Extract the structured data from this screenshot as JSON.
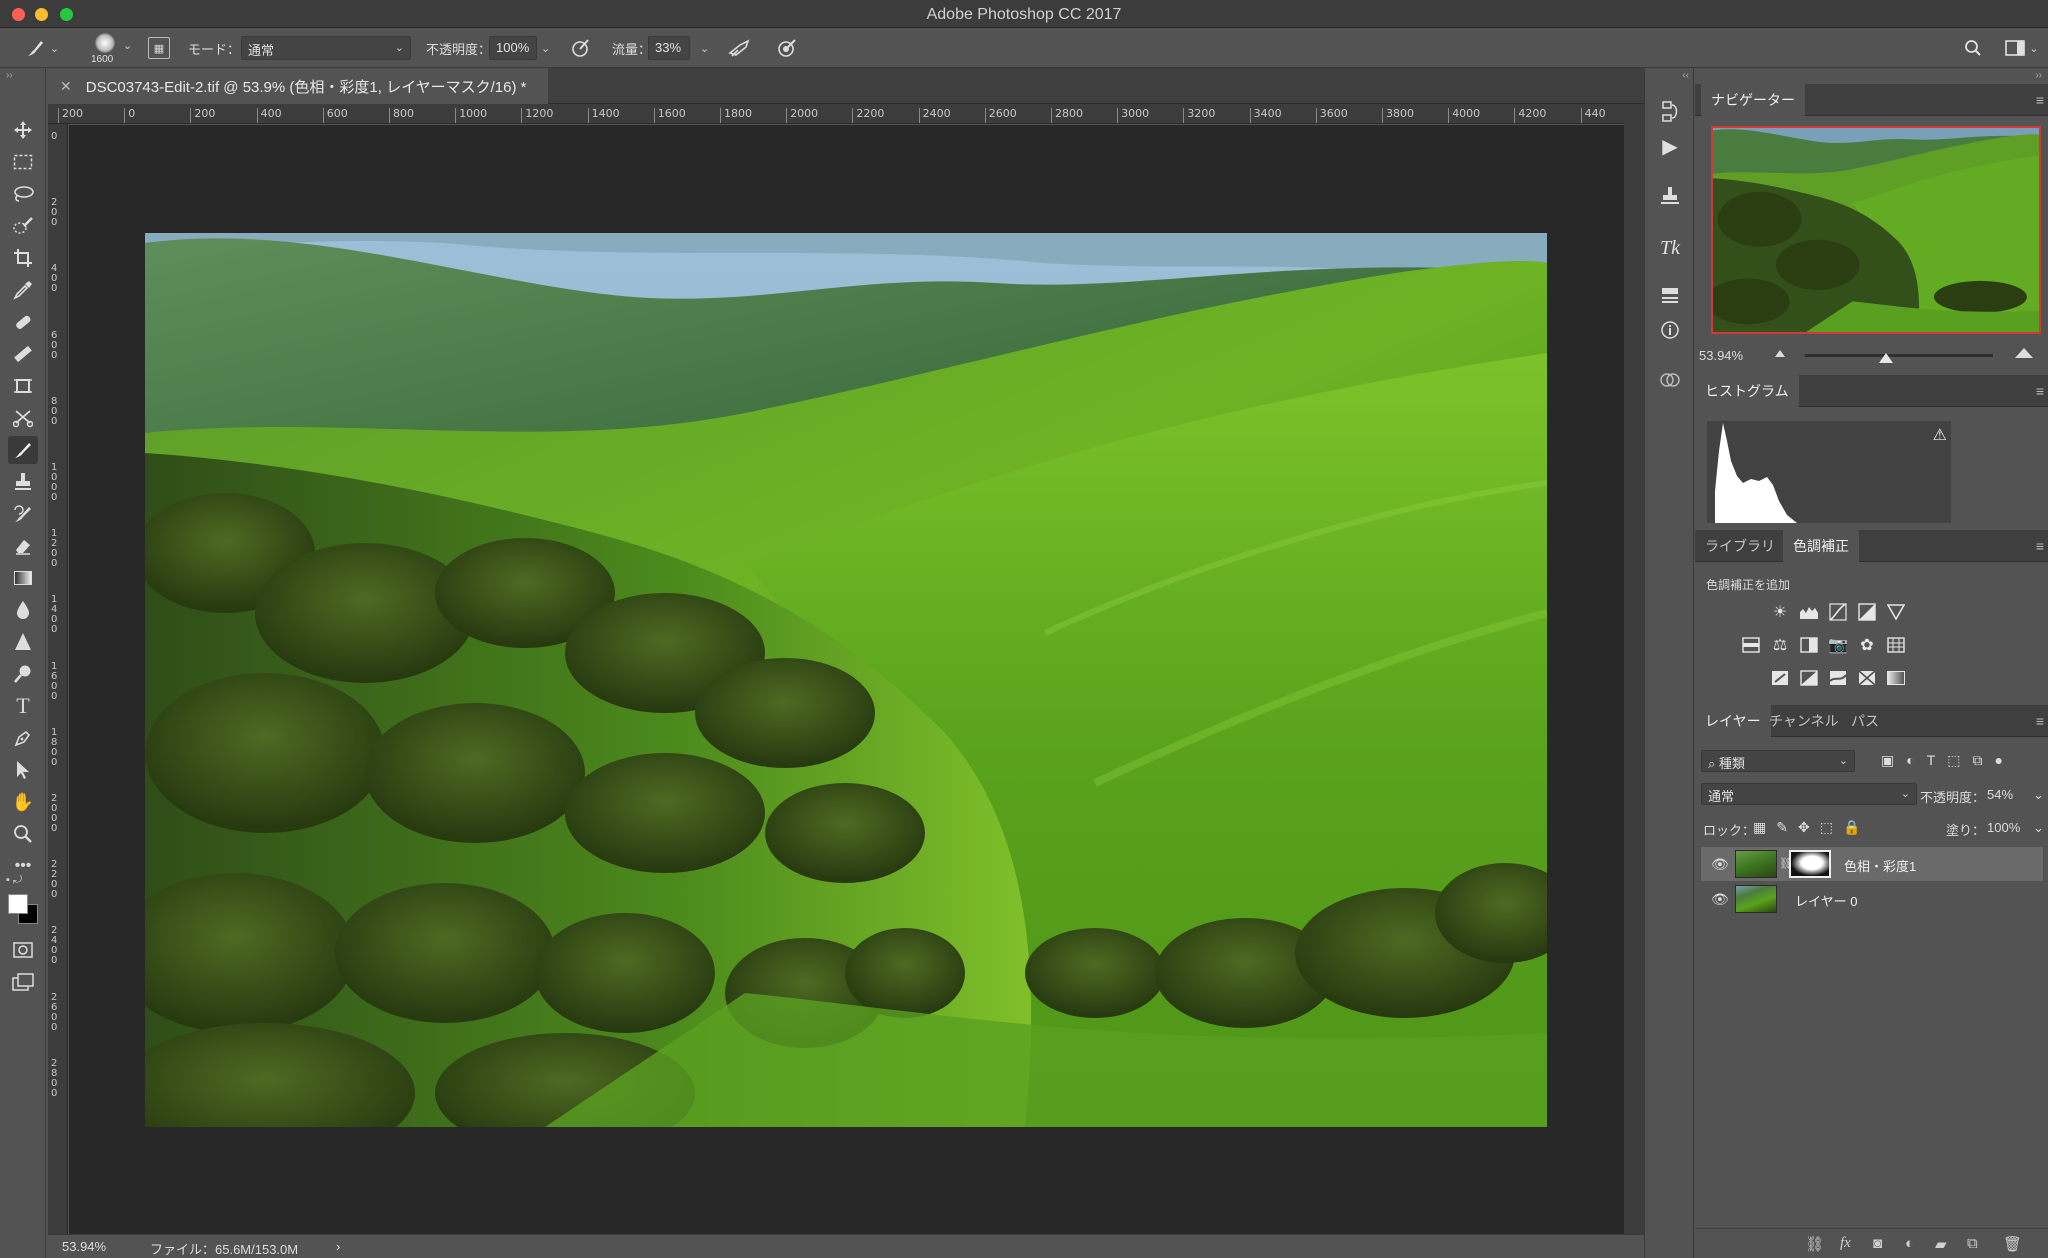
{
  "window": {
    "title": "Adobe Photoshop CC 2017"
  },
  "options": {
    "brush_size": "1600",
    "mode_label": "モード：",
    "mode_value": "通常",
    "opacity_label": "不透明度：",
    "opacity_value": "100%",
    "flow_label": "流量：",
    "flow_value": "33%"
  },
  "document": {
    "tab_title": "DSC03743-Edit-2.tif @ 53.9% (色相・彩度1, レイヤーマスク/16) *",
    "ruler_top": [
      "200",
      "0",
      "200",
      "400",
      "600",
      "800",
      "1000",
      "1200",
      "1400",
      "1600",
      "1800",
      "2000",
      "2200",
      "2400",
      "2600",
      "2800",
      "3000",
      "3200",
      "3400",
      "3600",
      "3800",
      "4000",
      "4200",
      "440"
    ],
    "ruler_left": [
      "0",
      "200",
      "400",
      "600",
      "800",
      "1000",
      "1200",
      "1400",
      "1600",
      "1800",
      "2000",
      "2200",
      "2400",
      "2600",
      "2800"
    ]
  },
  "status": {
    "zoom": "53.94%",
    "file": "ファイル：65.6M/153.0M",
    "arrow": "›"
  },
  "navigator": {
    "tab": "ナビゲーター",
    "zoom": "53.94%"
  },
  "histogram": {
    "tab": "ヒストグラム",
    "warning": "⚠"
  },
  "adjustments": {
    "tab_library": "ライブラリ",
    "tab_adjust": "色調補正",
    "add_label": "色調補正を追加"
  },
  "layers": {
    "tab_layers": "レイヤー",
    "tab_channels": "チャンネル",
    "tab_paths": "パス",
    "filter_kind": "種類",
    "blend_mode": "通常",
    "opacity_label": "不透明度：",
    "opacity_value": "54%",
    "lock_label": "ロック：",
    "fill_label": "塗り：",
    "fill_value": "100%",
    "items": [
      {
        "name": "色相・彩度1"
      },
      {
        "name": "レイヤー 0"
      }
    ]
  },
  "icons": {
    "toolbar": [
      "move-icon",
      "marquee-icon",
      "lasso-icon",
      "quick-select-icon",
      "crop-icon",
      "eyedropper-icon",
      "healing-icon",
      "ruler-icon",
      "frame-icon",
      "scissors-icon",
      "brush-icon",
      "stamp-icon",
      "history-brush-icon",
      "eraser-icon",
      "gradient-icon",
      "blur-icon",
      "sharpen-icon",
      "dodge-icon",
      "type-icon",
      "pen-icon",
      "path-select-icon",
      "hand-icon",
      "zoom-icon",
      "more-icon"
    ]
  }
}
